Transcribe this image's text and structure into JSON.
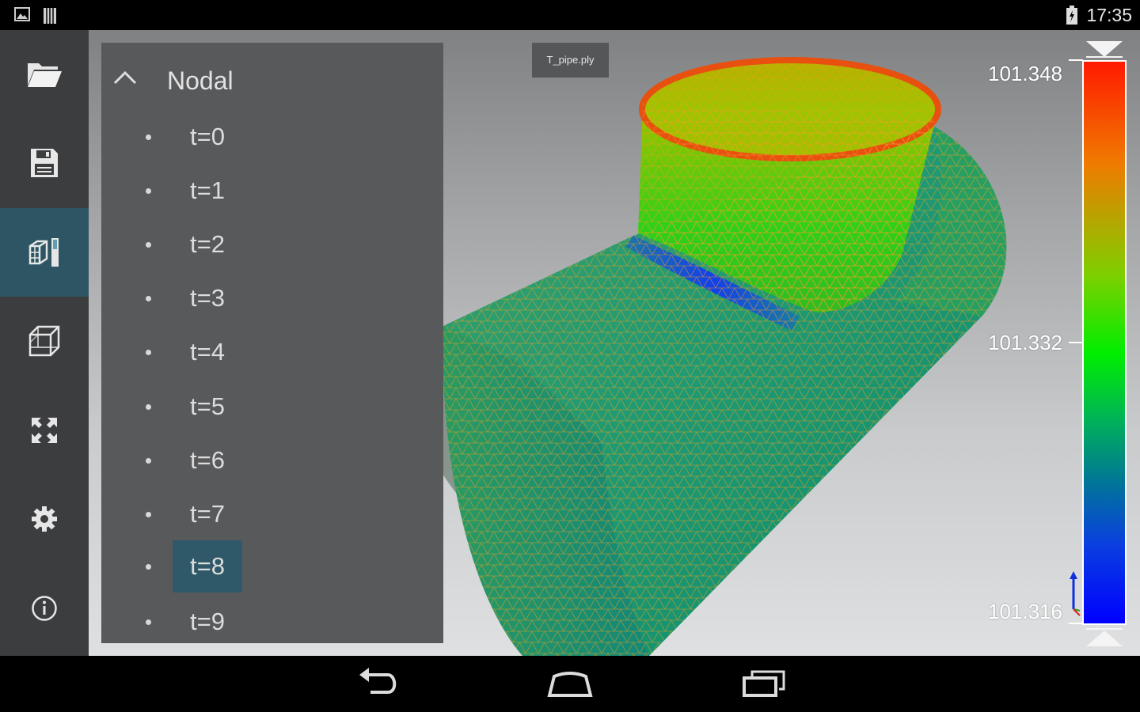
{
  "status_bar": {
    "time": "17:35",
    "icons": [
      "image-notification-icon",
      "sd-card-icon",
      "battery-icon"
    ]
  },
  "toolbar": {
    "items": [
      {
        "name": "open-folder-icon"
      },
      {
        "name": "save-icon"
      },
      {
        "name": "color-legend-icon",
        "active": true
      },
      {
        "name": "wireframe-cube-icon"
      },
      {
        "name": "fit-view-icon"
      },
      {
        "name": "settings-icon"
      },
      {
        "name": "info-icon"
      }
    ]
  },
  "tree": {
    "title": "Nodal",
    "items": [
      "t=0",
      "t=1",
      "t=2",
      "t=3",
      "t=4",
      "t=5",
      "t=6",
      "t=7",
      "t=8",
      "t=9"
    ],
    "selected": "t=8"
  },
  "viewport": {
    "file_name": "T_pipe.ply"
  },
  "legend": {
    "max": "101.348",
    "mid": "101.332",
    "min": "101.316",
    "colors": [
      "#ff1a00",
      "#00ee00",
      "#0000ff"
    ]
  },
  "nav_bar": {
    "buttons": [
      "back-icon",
      "home-icon",
      "recent-apps-icon"
    ]
  }
}
